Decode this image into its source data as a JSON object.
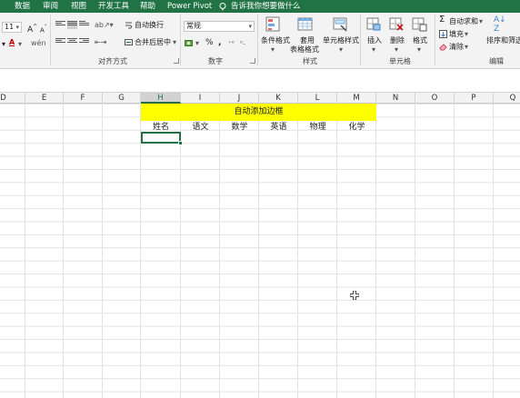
{
  "tabs": [
    "数据",
    "审阅",
    "视图",
    "开发工具",
    "帮助",
    "Power Pivot"
  ],
  "tell_me": "告诉我你想要做什么",
  "ribbon": {
    "font_size": "11",
    "grow_font": "A",
    "shrink_font": "A",
    "wrap_text": "自动换行",
    "merge_center": "合并后居中",
    "number_format": "常规",
    "percent": "%",
    "comma": ",",
    "cond_format": "条件格式",
    "format_table_1": "套用",
    "format_table_2": "表格格式",
    "cell_styles": "单元格样式",
    "insert": "插入",
    "delete": "删除",
    "format": "格式",
    "autosum": "自动求和",
    "fill": "填充",
    "clear": "清除",
    "sort_filter": "排序和筛选",
    "groups": {
      "alignment": "对齐方式",
      "number": "数字",
      "styles": "样式",
      "cells": "单元格",
      "editing": "编辑"
    }
  },
  "columns": [
    "D",
    "E",
    "F",
    "G",
    "H",
    "I",
    "J",
    "K",
    "L",
    "M",
    "N",
    "O",
    "P",
    "Q"
  ],
  "selected_column": "H",
  "sheet": {
    "banner": "自动添加边框",
    "headers": [
      "姓名",
      "语文",
      "数学",
      "英语",
      "物理",
      "化学"
    ]
  },
  "colors": {
    "excel_green": "#217346",
    "banner_fill": "#ffff00"
  }
}
